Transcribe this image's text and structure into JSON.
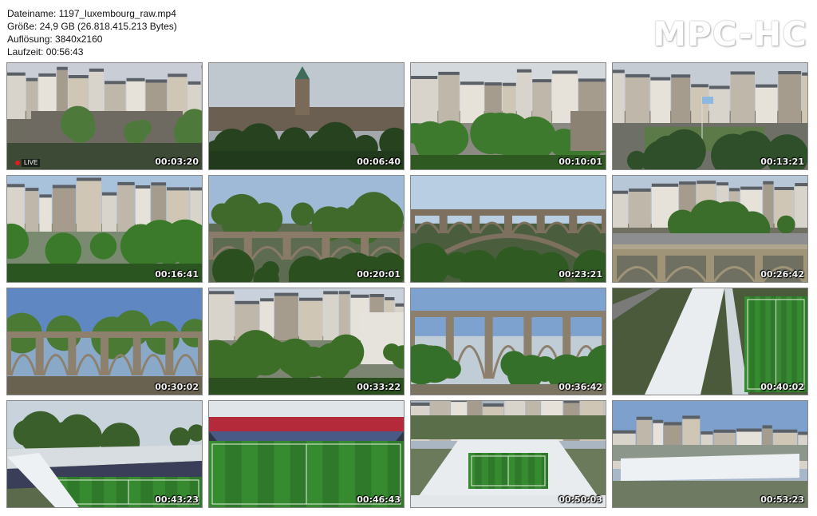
{
  "file_info": {
    "filename_line": "Dateiname: 1197_luxembourg_raw.mp4",
    "size_line": "Größe: 24,9 GB (26.818.415.213 Bytes)",
    "resolution_line": "Auflösung: 3840x2160",
    "duration_line": "Laufzeit: 00:56:43"
  },
  "logo": {
    "text": "MPC-HC"
  },
  "live_badge": {
    "text": "LIVE"
  },
  "thumbnails": [
    {
      "timestamp": "00:03:20",
      "scene": "city-square"
    },
    {
      "timestamp": "00:06:40",
      "scene": "clock-tower"
    },
    {
      "timestamp": "00:10:01",
      "scene": "old-town-trees"
    },
    {
      "timestamp": "00:13:21",
      "scene": "flag-square"
    },
    {
      "timestamp": "00:16:41",
      "scene": "valley-buildings"
    },
    {
      "timestamp": "00:20:01",
      "scene": "bridge-trees"
    },
    {
      "timestamp": "00:23:21",
      "scene": "arch-bridge"
    },
    {
      "timestamp": "00:26:42",
      "scene": "viaduct-road"
    },
    {
      "timestamp": "00:30:02",
      "scene": "viaduct-sky"
    },
    {
      "timestamp": "00:33:22",
      "scene": "town-forest"
    },
    {
      "timestamp": "00:36:42",
      "scene": "viaduct-close"
    },
    {
      "timestamp": "00:40:02",
      "scene": "stadium-roof"
    },
    {
      "timestamp": "00:43:23",
      "scene": "stadium-corner"
    },
    {
      "timestamp": "00:46:43",
      "scene": "stadium-pitch"
    },
    {
      "timestamp": "00:50:03",
      "scene": "stadium-top"
    },
    {
      "timestamp": "00:53:23",
      "scene": "stadium-distant"
    }
  ]
}
